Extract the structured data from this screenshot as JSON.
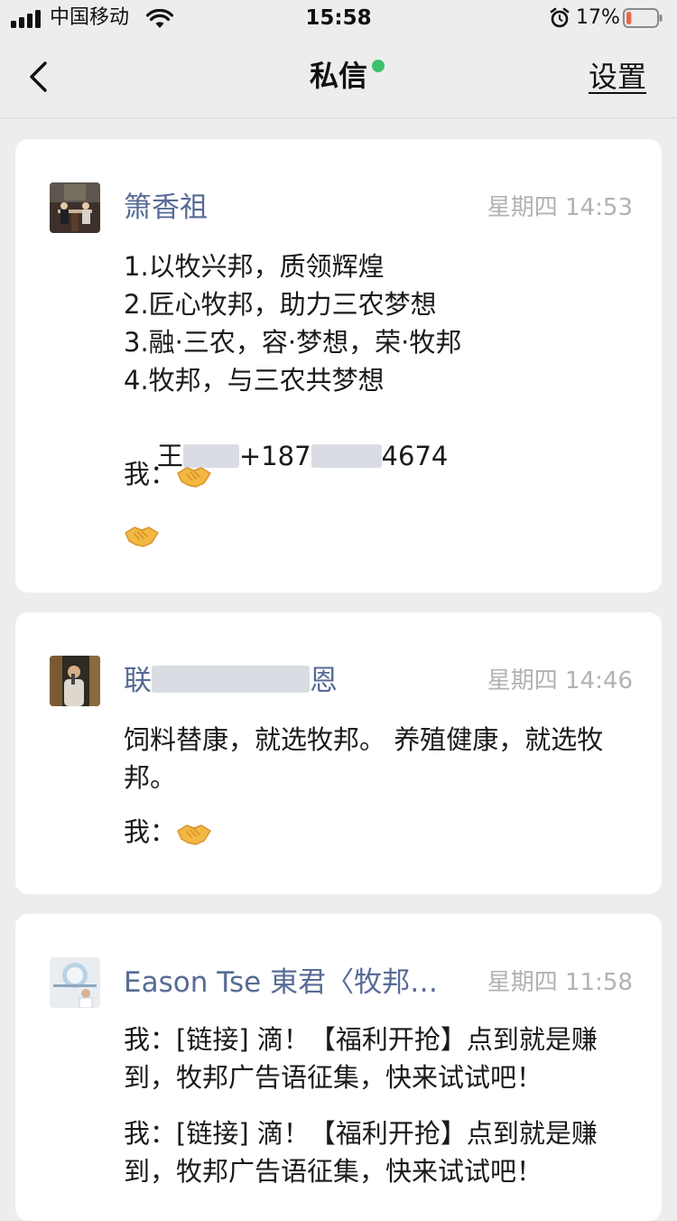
{
  "status_bar": {
    "carrier": "中国移动",
    "time": "15:58",
    "battery_percent": "17%",
    "battery_level": 0.17,
    "battery_color": "#e8694a",
    "icons": [
      "signal-icon",
      "wifi-icon",
      "alarm-icon",
      "battery-icon"
    ]
  },
  "nav": {
    "back_icon": "chevron-left-icon",
    "title": "私信",
    "online_color": "#3cc16e",
    "settings_label": "设置"
  },
  "messages": [
    {
      "sender": "箫香祖",
      "time": "星期四 14:53",
      "lines": [
        "1.以牧兴邦，质领辉煌",
        "2.匠心牧邦，助力三农梦想",
        "3.融·三农，容·梦想，荣·牧邦",
        "4.牧邦，与三农共梦想"
      ],
      "contact_prefix": "王",
      "contact_middle": "+187",
      "contact_suffix": "4674",
      "reply_label": "我：",
      "reply_emoji": "handshake-icon",
      "extra_emoji": "handshake-icon"
    },
    {
      "sender_prefix": "联",
      "sender_suffix": "恩",
      "time": "星期四 14:46",
      "text": "饲料替康，就选牧邦。 养殖健康，就选牧邦。",
      "reply_label": "我：",
      "reply_emoji": "handshake-icon"
    },
    {
      "sender": "Eason Tse 東君〈牧邦…",
      "time": "星期四 11:58",
      "text_1": "我：[链接] 滴！【福利开抢】点到就是赚到，牧邦广告语征集，快来试试吧！",
      "text_2": "我：[链接] 滴！【福利开抢】点到就是赚到，牧邦广告语征集，快来试试吧！"
    }
  ],
  "colors": {
    "background": "#ededed",
    "card": "#ffffff",
    "sender_name": "#576b95",
    "timestamp": "#b2b2b2"
  }
}
